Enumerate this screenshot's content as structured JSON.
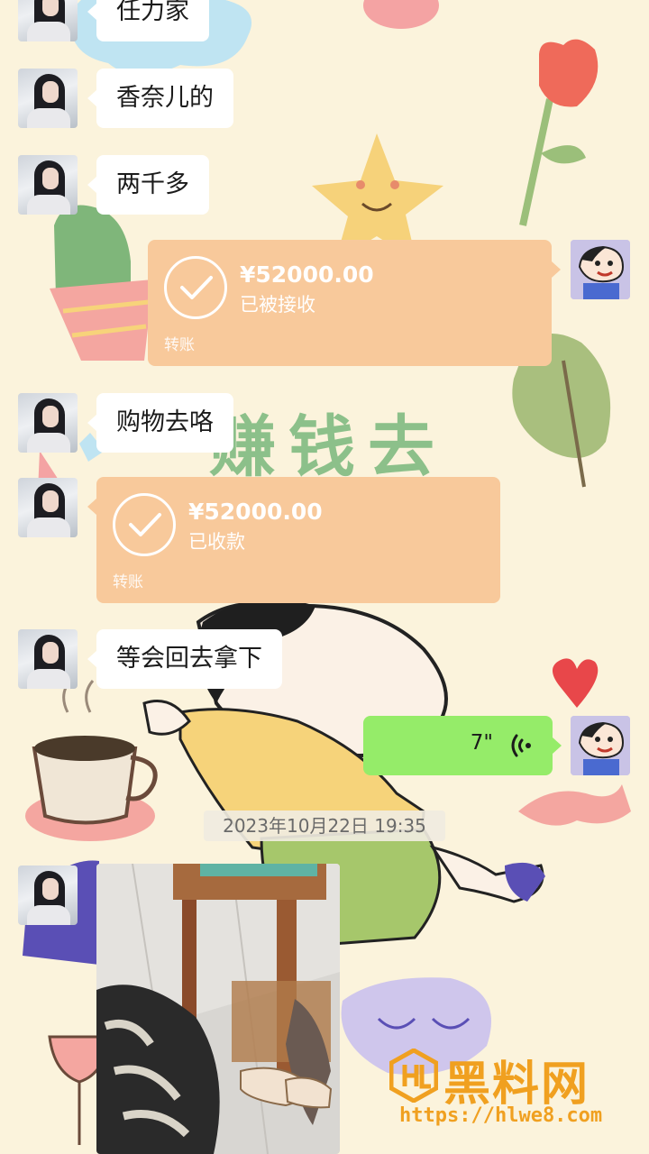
{
  "chat": {
    "partial_top_message": "任力家",
    "messages": [
      {
        "text": "香奈儿的"
      },
      {
        "text": "两千多"
      },
      {
        "text": "购物去咯"
      },
      {
        "text": "等会回去拿下"
      }
    ],
    "transfer_sent": {
      "amount": "¥52000.00",
      "status": "已被接收",
      "label": "转账"
    },
    "transfer_received": {
      "amount": "¥52000.00",
      "status": "已收款",
      "label": "转账"
    },
    "voice": {
      "duration": "7\""
    },
    "timestamp": "2023年10月22日 19:35"
  },
  "wallpaper": {
    "deco_text": "赚钱去"
  },
  "watermark": {
    "brand": "黑料网",
    "url": "https://hlwe8.com"
  },
  "colors": {
    "transfer_orange": "#f8c99b",
    "voice_green": "#95ec69",
    "background_cream": "#fbf3dc",
    "watermark_orange": "#f0a020"
  }
}
